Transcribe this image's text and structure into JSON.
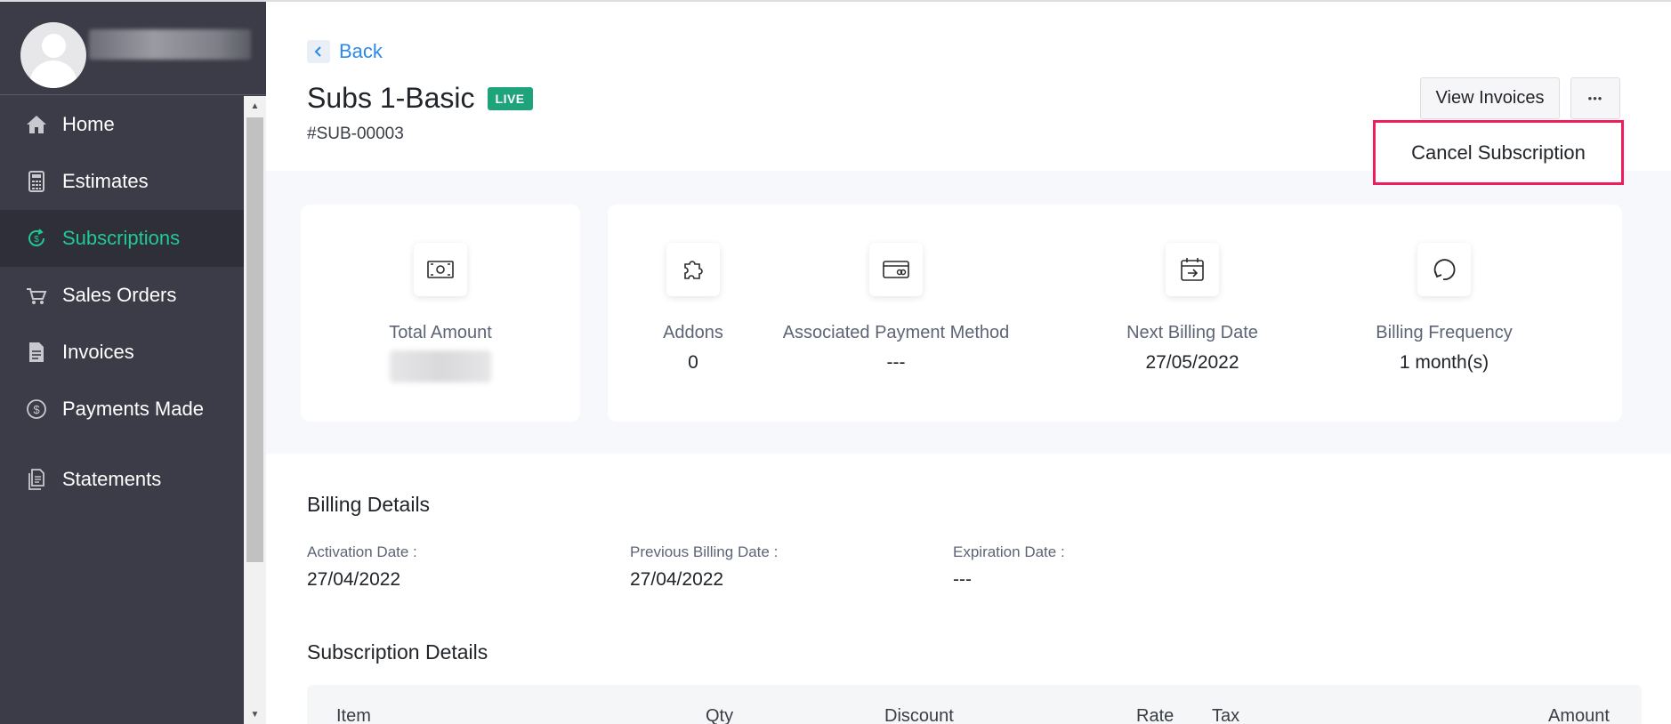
{
  "sidebar": {
    "items": [
      {
        "label": "Home",
        "icon": "home-icon"
      },
      {
        "label": "Estimates",
        "icon": "calculator-icon"
      },
      {
        "label": "Subscriptions",
        "icon": "subscription-icon",
        "active": true
      },
      {
        "label": "Sales Orders",
        "icon": "cart-icon"
      },
      {
        "label": "Invoices",
        "icon": "invoice-icon"
      },
      {
        "label": "Payments Made",
        "icon": "dollar-circle-icon"
      },
      {
        "label": "Statements",
        "icon": "statement-icon"
      }
    ],
    "active_color": "#20c997"
  },
  "header": {
    "back_label": "Back",
    "title": "Subs 1-Basic",
    "status_badge": "LIVE",
    "subscription_id": "#SUB-00003",
    "view_invoices_label": "View Invoices",
    "more_label": "•••",
    "cancel_label": "Cancel Subscription"
  },
  "summary": {
    "total_amount_label": "Total Amount",
    "stats": [
      {
        "label": "Addons",
        "value": "0",
        "icon": "puzzle-icon"
      },
      {
        "label": "Associated Payment Method",
        "value": "---",
        "icon": "card-icon"
      },
      {
        "label": "Next Billing Date",
        "value": "27/05/2022",
        "icon": "calendar-icon"
      },
      {
        "label": "Billing Frequency",
        "value": "1 month(s)",
        "icon": "refresh-icon"
      }
    ]
  },
  "billing": {
    "title": "Billing Details",
    "activation_label": "Activation Date :",
    "activation_value": "27/04/2022",
    "previous_label": "Previous Billing Date :",
    "previous_value": "27/04/2022",
    "expiration_label": "Expiration Date :",
    "expiration_value": "---"
  },
  "subscription_details": {
    "title": "Subscription Details",
    "columns": [
      "Item",
      "Qty",
      "Discount",
      "Rate",
      "Tax",
      "Amount"
    ]
  },
  "colors": {
    "sidebar_bg": "#3b3c47",
    "link": "#2d8ae6",
    "live_badge": "#1fa37b",
    "highlight_border": "#ef1d5c"
  }
}
